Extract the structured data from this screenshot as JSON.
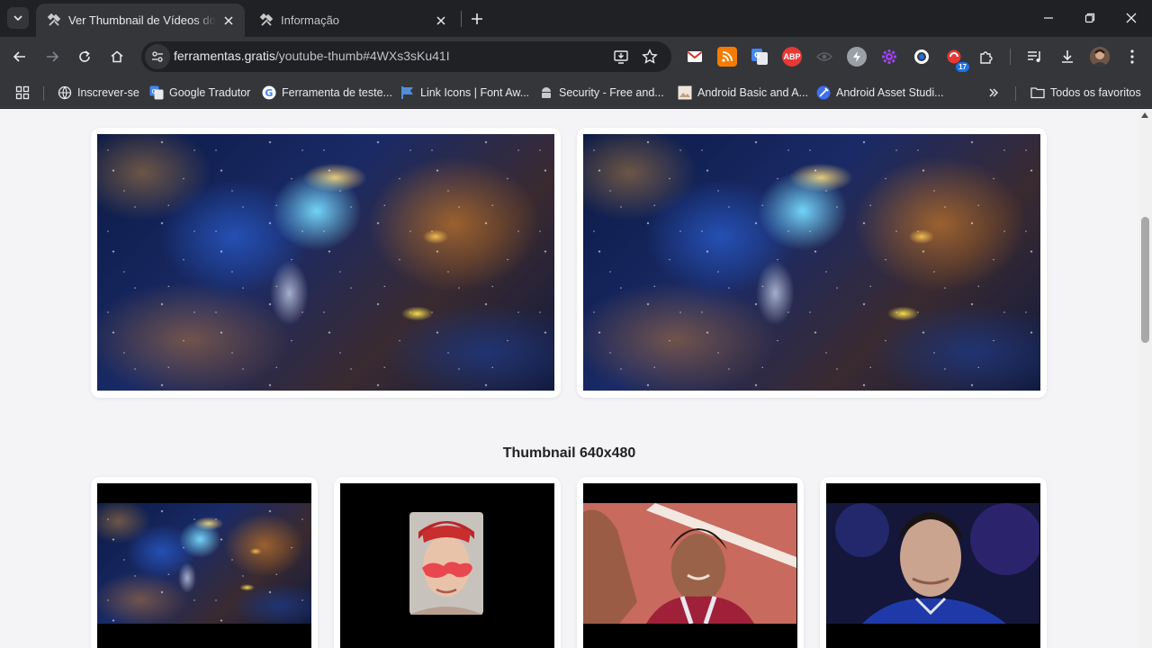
{
  "browser": {
    "tabs": [
      {
        "title": "Ver Thumbnail de Vídeos do Youtube",
        "active": true,
        "favicon": "tools-icon"
      },
      {
        "title": "Informação",
        "active": false,
        "favicon": "tools-icon"
      }
    ],
    "address": {
      "host": "ferramentas.gratis",
      "path": "/youtube-thumb#4WXs3sKu41I"
    },
    "extensions": [
      {
        "name": "gmail-icon",
        "color": "#d93025"
      },
      {
        "name": "rss-icon",
        "color": "#f57c00"
      },
      {
        "name": "translate-icon",
        "color": "#4285f4"
      },
      {
        "name": "adblock-plus-icon",
        "color": "#e53935",
        "label": "ABP"
      },
      {
        "name": "eye-icon",
        "color": "#5f6368"
      },
      {
        "name": "bolt-icon",
        "color": "#9aa0a6"
      },
      {
        "name": "gear-flower-icon",
        "color": "#a142f4"
      },
      {
        "name": "ring-icon",
        "color": "#1a73e8"
      },
      {
        "name": "notification-extension-icon",
        "color": "#e53935",
        "badge": "17"
      },
      {
        "name": "puzzle-icon",
        "color": "#e8eaed"
      }
    ],
    "bookmarks": [
      {
        "label": "Inscrever-se",
        "icon": "globe-icon"
      },
      {
        "label": "Google Tradutor",
        "icon": "translate-icon"
      },
      {
        "label": "Ferramenta de teste...",
        "icon": "google-icon"
      },
      {
        "label": "Link Icons | Font Aw...",
        "icon": "flag-icon"
      },
      {
        "label": "Security - Free and...",
        "icon": "android-icon"
      },
      {
        "label": "Android Basic and A...",
        "icon": "image-icon"
      },
      {
        "label": "Android Asset Studi...",
        "icon": "magic-icon"
      }
    ],
    "all_bookmarks_label": "Todos os favoritos"
  },
  "page": {
    "section_640_title": "Thumbnail 640x480"
  }
}
